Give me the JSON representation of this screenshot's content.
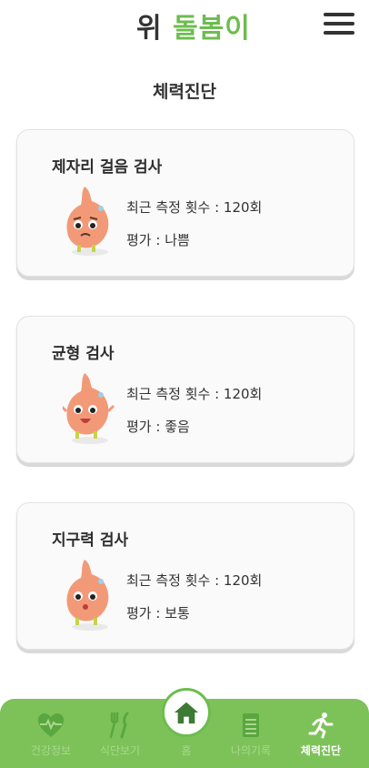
{
  "header": {
    "logo_part1": "위",
    "logo_part2": "돌봄이",
    "menu_icon": "hamburger-menu-icon"
  },
  "page": {
    "title": "체력진단"
  },
  "cards": [
    {
      "title": "제자리 걸음 검사",
      "count_label": "최근 측정 횟수 : 120회",
      "rating_label": "평가 : 나쁨",
      "mascot": "sad-stomach-mascot"
    },
    {
      "title": "균형 검사",
      "count_label": "최근 측정 횟수 : 120회",
      "rating_label": "평가 : 좋음",
      "mascot": "happy-stomach-mascot"
    },
    {
      "title": "지구력 검사",
      "count_label": "최근 측정 횟수 : 120회",
      "rating_label": "평가 : 보통",
      "mascot": "neutral-stomach-mascot"
    }
  ],
  "nav": {
    "health": "건강정보",
    "diet": "식단보기",
    "home": "홈",
    "records": "나의기록",
    "fitness": "체력진단",
    "active": "fitness"
  },
  "colors": {
    "brand_green": "#6cbd4e",
    "nav_bg": "#7cc258",
    "nav_inactive": "#a8d88e"
  }
}
